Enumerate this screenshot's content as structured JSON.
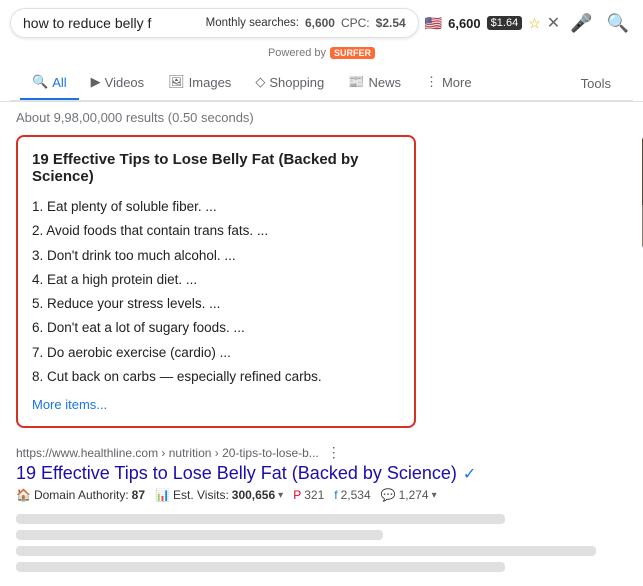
{
  "searchbar": {
    "query": "how to reduce belly f",
    "monthly_label": "Monthly searches:",
    "monthly_value": "6,600",
    "cpc_label": "CPC:",
    "cpc_value": "$2.54",
    "volume": "6,600",
    "cpc_badge": "$1.64",
    "powered_by": "Powered by",
    "surfer_label": "SURFER"
  },
  "tabs": [
    {
      "id": "all",
      "label": "All",
      "icon": "🔍",
      "active": true
    },
    {
      "id": "videos",
      "label": "Videos",
      "icon": "▶",
      "active": false
    },
    {
      "id": "images",
      "label": "Images",
      "icon": "🖼",
      "active": false
    },
    {
      "id": "shopping",
      "label": "Shopping",
      "icon": "◇",
      "active": false
    },
    {
      "id": "news",
      "label": "News",
      "icon": "📰",
      "active": false
    },
    {
      "id": "more",
      "label": "More",
      "icon": "⋮",
      "active": false
    }
  ],
  "tools_label": "Tools",
  "results_count": "About 9,98,00,000 results (0.50 seconds)",
  "featured_snippet": {
    "title": "19 Effective Tips to Lose Belly Fat (Backed by Science)",
    "items": [
      "1.  Eat plenty of soluble fiber. ...",
      "2.  Avoid foods that contain trans fats. ...",
      "3.  Don't drink too much alcohol. ...",
      "4.  Eat a high protein diet. ...",
      "5.  Reduce your stress levels. ...",
      "6.  Don't eat a lot of sugary foods. ...",
      "7.  Do aerobic exercise (cardio) ...",
      "8.  Cut back on carbs — especially refined carbs."
    ],
    "more_items_link": "More items..."
  },
  "result": {
    "url": "https://www.healthline.com › nutrition › 20-tips-to-lose-b...",
    "title": "19 Effective Tips to Lose Belly Fat (Backed by Science)",
    "domain_auth_label": "Domain Authority:",
    "domain_auth_value": "87",
    "est_visits_label": "Est. Visits:",
    "est_visits_value": "300,656",
    "pinterest_label": "321",
    "facebook_label": "2,534",
    "comments_label": "1,274"
  }
}
